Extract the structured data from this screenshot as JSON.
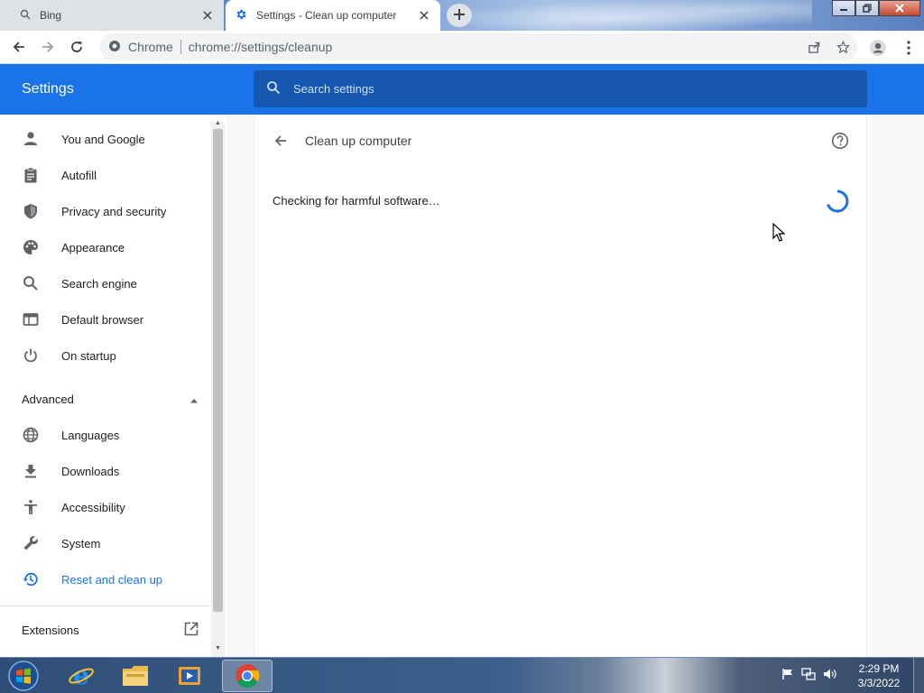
{
  "browser": {
    "tabs": [
      {
        "title": "Bing",
        "icon": "search-icon",
        "active": false
      },
      {
        "title": "Settings - Clean up computer",
        "icon": "gear-icon",
        "active": true
      }
    ],
    "omnibox": {
      "site_label": "Chrome",
      "url": "chrome://settings/cleanup"
    }
  },
  "settings": {
    "title": "Settings",
    "search_placeholder": "Search settings",
    "sidebar": {
      "items": [
        {
          "label": "You and Google",
          "icon": "person-icon"
        },
        {
          "label": "Autofill",
          "icon": "clipboard-icon"
        },
        {
          "label": "Privacy and security",
          "icon": "shield-icon"
        },
        {
          "label": "Appearance",
          "icon": "palette-icon"
        },
        {
          "label": "Search engine",
          "icon": "search-icon"
        },
        {
          "label": "Default browser",
          "icon": "browser-window-icon"
        },
        {
          "label": "On startup",
          "icon": "power-icon"
        }
      ],
      "advanced_label": "Advanced",
      "advanced_items": [
        {
          "label": "Languages",
          "icon": "globe-icon"
        },
        {
          "label": "Downloads",
          "icon": "download-icon"
        },
        {
          "label": "Accessibility",
          "icon": "accessibility-icon"
        },
        {
          "label": "System",
          "icon": "wrench-icon"
        },
        {
          "label": "Reset and clean up",
          "icon": "history-icon",
          "selected": true
        }
      ],
      "extensions_label": "Extensions"
    },
    "page": {
      "title": "Clean up computer",
      "status": "Checking for harmful software…"
    },
    "accent_color": "#1a73e8"
  },
  "taskbar": {
    "time": "2:29 PM",
    "date": "3/3/2022",
    "apps": [
      "internet-explorer-icon",
      "file-explorer-icon",
      "media-player-icon",
      "chrome-icon"
    ]
  }
}
